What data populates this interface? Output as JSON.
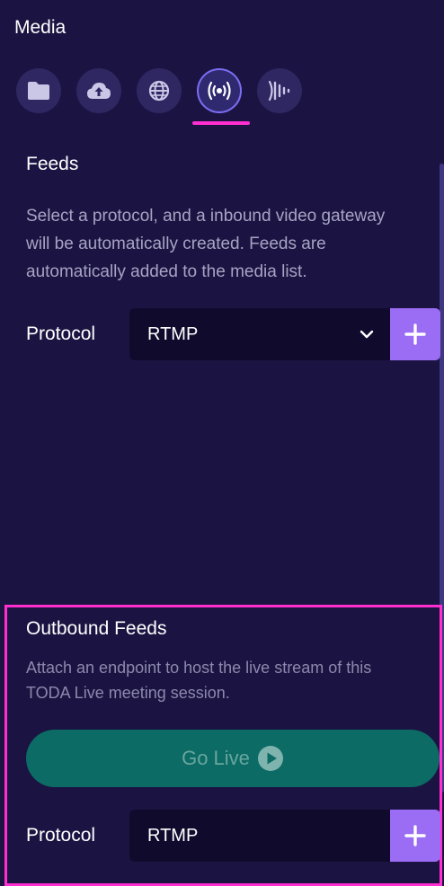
{
  "header": {
    "title": "Media"
  },
  "tabs": [
    {
      "icon": "folder-icon",
      "active": false
    },
    {
      "icon": "cloud-upload-icon",
      "active": false
    },
    {
      "icon": "globe-icon",
      "active": false
    },
    {
      "icon": "broadcast-icon",
      "active": true
    },
    {
      "icon": "audio-wave-icon",
      "active": false
    }
  ],
  "feeds": {
    "title": "Feeds",
    "description_lines": [
      "Select a protocol, and a inbound video gateway",
      "will be automatically created. Feeds are",
      "automatically added to the media list."
    ],
    "protocol_label": "Protocol",
    "protocol_value": "RTMP"
  },
  "outbound": {
    "title": "Outbound Feeds",
    "description_lines": [
      "Attach an endpoint to host the live stream of this",
      "TODA Live meeting session."
    ],
    "go_live_label": "Go Live",
    "protocol_label": "Protocol",
    "protocol_value": "RTMP"
  },
  "colors": {
    "background": "#1b1442",
    "accent_purple": "#9b6cf4",
    "highlight_magenta": "#ff2fd0",
    "go_live_teal": "#0c6b64"
  }
}
